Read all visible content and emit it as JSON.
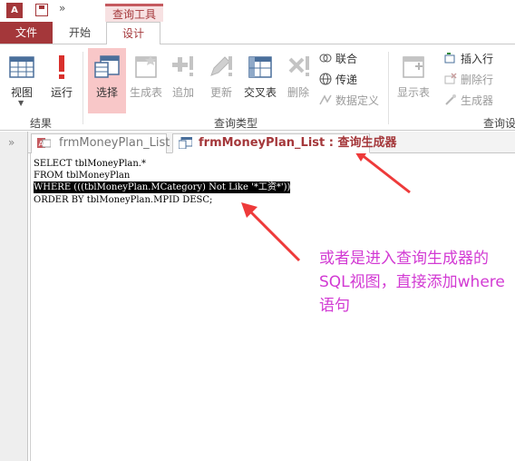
{
  "quick_access": {
    "app_icon_text": "A",
    "more_glyph": "»"
  },
  "context_tab_group": "查询工具",
  "tabs": {
    "file": "文件",
    "start": "开始",
    "design": "设计"
  },
  "ribbon": {
    "results": {
      "view": "视图",
      "run": "运行",
      "group_label": "结果"
    },
    "query_type": {
      "select": "选择",
      "make_table": "生成表",
      "append": "追加",
      "update": "更新",
      "crosstab": "交叉表",
      "delete": "删除",
      "union": "联合",
      "pass_through": "传递",
      "data_definition": "数据定义",
      "group_label": "查询类型"
    },
    "setup": {
      "show_table": "显示表",
      "insert_row": "插入行",
      "delete_row": "删除行",
      "builder": "生成器",
      "group_label": "查询设"
    }
  },
  "document_tabs": {
    "nav_toggle": "»",
    "form_tab": "frmMoneyPlan_List",
    "query_tab": "frmMoneyPlan_List : 查询生成器"
  },
  "sql": {
    "lines": [
      "SELECT tblMoneyPlan.*",
      "FROM tblMoneyPlan",
      "WHERE (((tblMoneyPlan.MCategory) Not Like '*工资*'))",
      "ORDER BY tblMoneyPlan.MPID DESC;"
    ]
  },
  "annotation": {
    "text": "或者是进入查询生成器的SQL视图，直接添加where语句"
  },
  "colors": {
    "accent": "#a4373a",
    "annotation": "#d23ad3",
    "arrow": "#ee3a3a"
  }
}
